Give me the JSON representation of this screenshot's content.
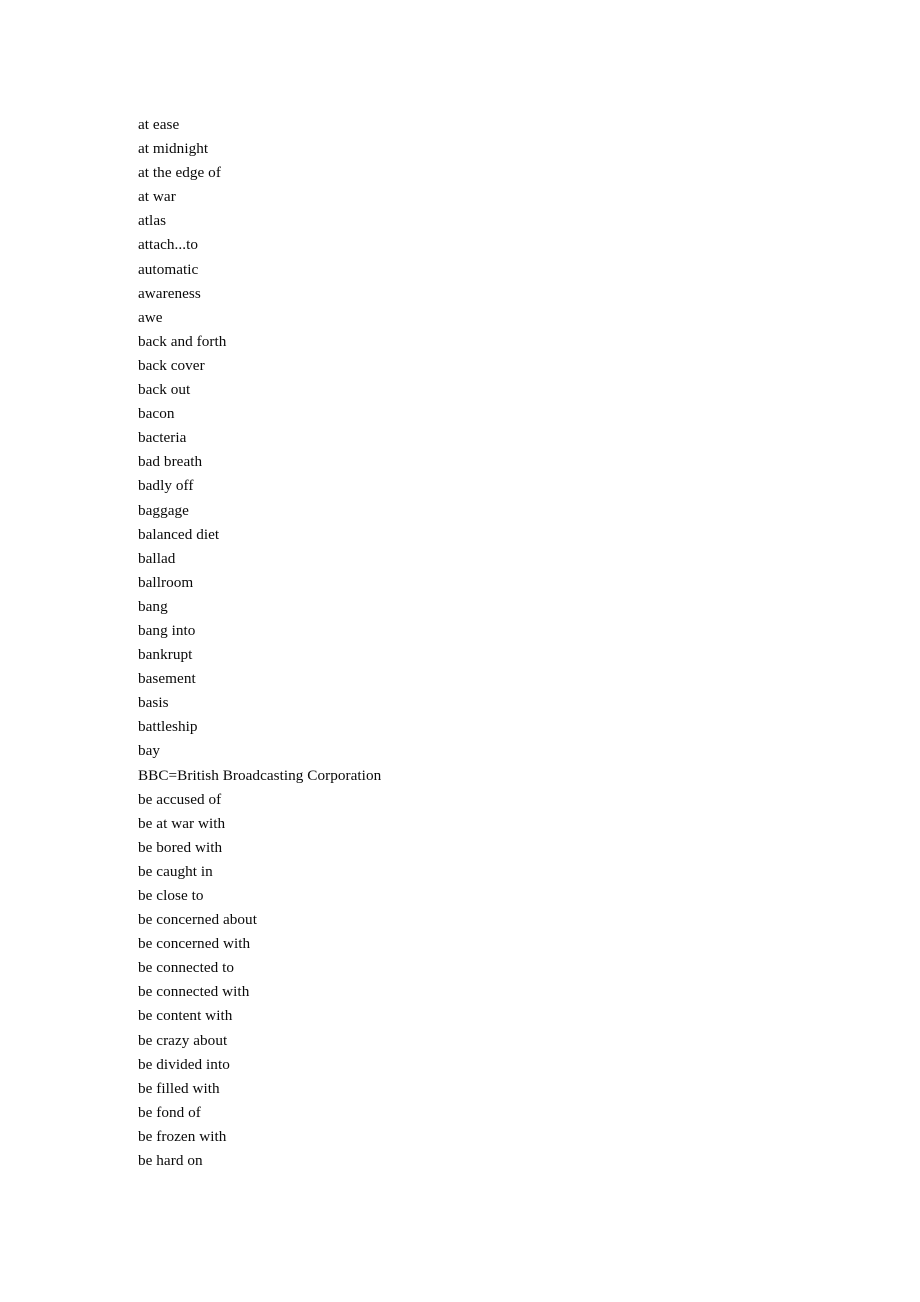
{
  "document": {
    "type": "vocabulary-word-list",
    "background_color": "#ffffff",
    "text_color": "#0a0a0a",
    "entries": [
      "at ease",
      "at midnight",
      "at the edge of",
      "at war",
      "atlas",
      "attach...to",
      "automatic",
      "awareness",
      "awe",
      "back and forth",
      "back cover",
      "back out",
      "bacon",
      "bacteria",
      "bad breath",
      "badly off",
      "baggage",
      "balanced diet",
      "ballad",
      "ballroom",
      "bang",
      "bang into",
      "bankrupt",
      "basement",
      "basis",
      "battleship",
      "bay",
      "BBC=British Broadcasting Corporation",
      "be accused of",
      "be at war with",
      "be bored with",
      "be caught in",
      "be close to",
      "be concerned about",
      "be concerned with",
      "be connected to",
      "be connected with",
      "be content with",
      "be crazy about",
      "be divided into",
      "be filled with",
      "be fond of",
      "be frozen with",
      "be hard on"
    ]
  }
}
